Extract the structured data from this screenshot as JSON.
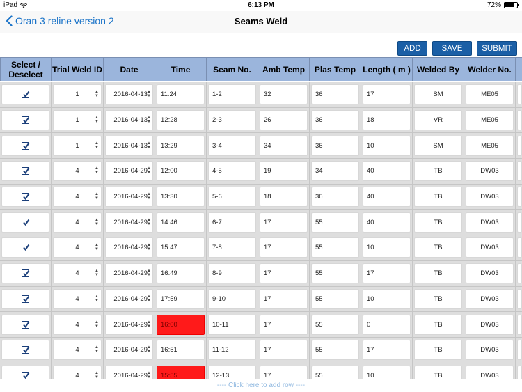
{
  "status": {
    "device": "iPad",
    "time": "6:13 PM",
    "battery": "72%",
    "battery_level": 0.72
  },
  "nav": {
    "back_label": "Oran 3 reline version 2",
    "title": "Seams Weld"
  },
  "toolbar": {
    "add": "ADD",
    "save": "SAVE",
    "submit": "SUBMIT"
  },
  "table": {
    "headers": [
      "Select / Deselect",
      "Trial Weld ID",
      "Date",
      "Time",
      "Seam No.",
      "Amb Temp",
      "Plas Temp",
      "Length ( m )",
      "Welded By",
      "Welder No."
    ],
    "rows": [
      {
        "selected": true,
        "trial": "1",
        "date": "2016-04-13",
        "time": "11:24",
        "time_flag": false,
        "seam": "1-2",
        "amb": "32",
        "plas": "36",
        "length": "17",
        "by": "SM",
        "welder": "ME05"
      },
      {
        "selected": true,
        "trial": "1",
        "date": "2016-04-13",
        "time": "12:28",
        "time_flag": false,
        "seam": "2-3",
        "amb": "26",
        "plas": "36",
        "length": "18",
        "by": "VR",
        "welder": "ME05"
      },
      {
        "selected": true,
        "trial": "1",
        "date": "2016-04-13",
        "time": "13:29",
        "time_flag": false,
        "seam": "3-4",
        "amb": "34",
        "plas": "36",
        "length": "10",
        "by": "SM",
        "welder": "ME05"
      },
      {
        "selected": true,
        "trial": "4",
        "date": "2016-04-29",
        "time": "12:00",
        "time_flag": false,
        "seam": "4-5",
        "amb": "19",
        "plas": "34",
        "length": "40",
        "by": "TB",
        "welder": "DW03"
      },
      {
        "selected": true,
        "trial": "4",
        "date": "2016-04-29",
        "time": "13:30",
        "time_flag": false,
        "seam": "5-6",
        "amb": "18",
        "plas": "36",
        "length": "40",
        "by": "TB",
        "welder": "DW03"
      },
      {
        "selected": true,
        "trial": "4",
        "date": "2016-04-29",
        "time": "14:46",
        "time_flag": false,
        "seam": "6-7",
        "amb": "17",
        "plas": "55",
        "length": "40",
        "by": "TB",
        "welder": "DW03"
      },
      {
        "selected": true,
        "trial": "4",
        "date": "2016-04-29",
        "time": "15:47",
        "time_flag": false,
        "seam": "7-8",
        "amb": "17",
        "plas": "55",
        "length": "10",
        "by": "TB",
        "welder": "DW03"
      },
      {
        "selected": true,
        "trial": "4",
        "date": "2016-04-29",
        "time": "16:49",
        "time_flag": false,
        "seam": "8-9",
        "amb": "17",
        "plas": "55",
        "length": "17",
        "by": "TB",
        "welder": "DW03"
      },
      {
        "selected": true,
        "trial": "4",
        "date": "2016-04-29",
        "time": "17:59",
        "time_flag": false,
        "seam": "9-10",
        "amb": "17",
        "plas": "55",
        "length": "10",
        "by": "TB",
        "welder": "DW03"
      },
      {
        "selected": true,
        "trial": "4",
        "date": "2016-04-29",
        "time": "16:00",
        "time_flag": true,
        "seam": "10-11",
        "amb": "17",
        "plas": "55",
        "length": "0",
        "by": "TB",
        "welder": "DW03"
      },
      {
        "selected": true,
        "trial": "4",
        "date": "2016-04-29",
        "time": "16:51",
        "time_flag": false,
        "seam": "11-12",
        "amb": "17",
        "plas": "55",
        "length": "17",
        "by": "TB",
        "welder": "DW03"
      },
      {
        "selected": true,
        "trial": "4",
        "date": "2016-04-29",
        "time": "15:55",
        "time_flag": true,
        "seam": "12-13",
        "amb": "17",
        "plas": "55",
        "length": "10",
        "by": "TB",
        "welder": "DW03"
      }
    ]
  },
  "footer": {
    "add_row": "----  Click here to add row  ----"
  },
  "colors": {
    "header_bg": "#9bb5dc",
    "button_bg": "#1b5fa6",
    "row_bg": "#dedede",
    "flag_red": "#ff1a1a",
    "link_blue": "#1a73c8"
  }
}
